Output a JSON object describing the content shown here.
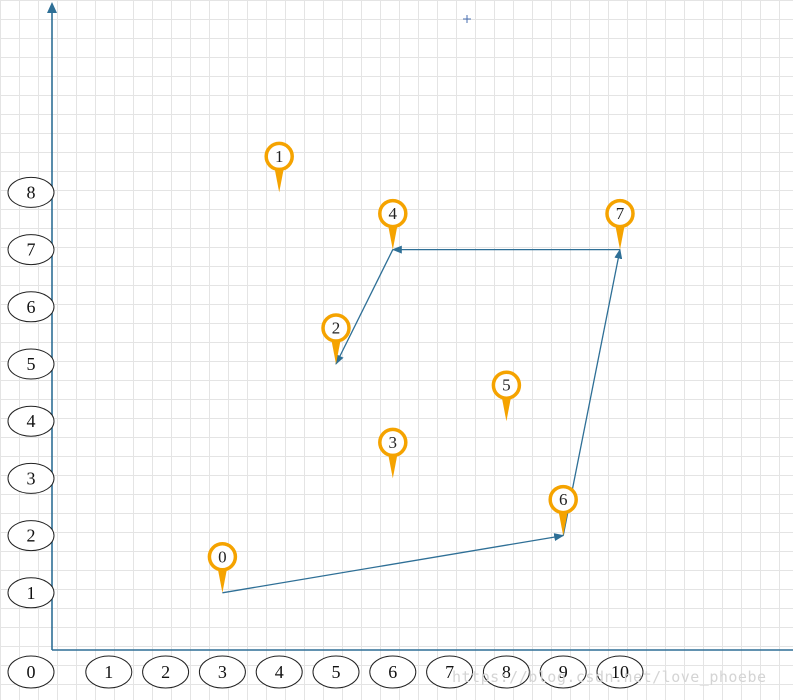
{
  "chart_data": {
    "type": "scatter",
    "x_ticks": [
      "1",
      "2",
      "3",
      "4",
      "5",
      "6",
      "7",
      "8",
      "9",
      "10"
    ],
    "y_ticks": [
      "1",
      "2",
      "3",
      "4",
      "5",
      "6",
      "7",
      "8"
    ],
    "origin_label": "0",
    "points": [
      {
        "label": "0",
        "x": 3,
        "y": 1
      },
      {
        "label": "1",
        "x": 4,
        "y": 8
      },
      {
        "label": "2",
        "x": 5,
        "y": 5
      },
      {
        "label": "3",
        "x": 6,
        "y": 3
      },
      {
        "label": "4",
        "x": 6,
        "y": 7
      },
      {
        "label": "5",
        "x": 8,
        "y": 4
      },
      {
        "label": "6",
        "x": 9,
        "y": 2
      },
      {
        "label": "7",
        "x": 10,
        "y": 7
      }
    ],
    "path": [
      "0",
      "6",
      "7",
      "4",
      "2"
    ],
    "grid": true,
    "colors": {
      "axis": "#2e6f96",
      "marker": "#f5a300",
      "path": "#2e6f96",
      "grid": "#e4e4e4"
    }
  },
  "watermark": "https://blog.csdn.net/love_phoebe"
}
